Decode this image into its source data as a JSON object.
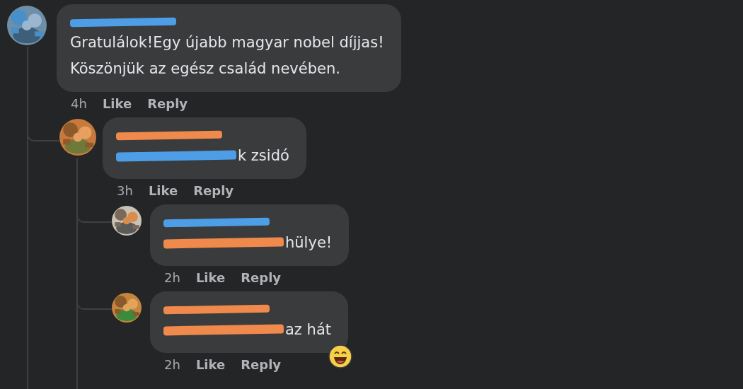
{
  "comments": [
    {
      "avatar": {
        "kind": "picture"
      },
      "name_redaction": {
        "color": "#4d9ee6"
      },
      "body": {
        "text": "Gratulálok!Egy újabb magyar nobel díjjas!\nKöszönjük az egész család nevében."
      },
      "time": "4h",
      "actions": [
        "Like",
        "Reply"
      ],
      "children": [
        {
          "avatar": {
            "kind": "picture"
          },
          "name_redaction": {
            "color": "#ef8a4c"
          },
          "body": {
            "redaction": {
              "color": "#4d9ee6"
            },
            "text": "k zsidó"
          },
          "time": "3h",
          "actions": [
            "Like",
            "Reply"
          ],
          "children": [
            {
              "avatar": {
                "kind": "picture"
              },
              "name_redaction": {
                "color": "#4d9ee6"
              },
              "body": {
                "redaction": {
                  "color": "#ef8a4c"
                },
                "text": "hülye!"
              },
              "time": "2h",
              "actions": [
                "Like",
                "Reply"
              ]
            },
            {
              "avatar": {
                "kind": "picture"
              },
              "name_redaction": {
                "color": "#ef8a4c"
              },
              "body": {
                "redaction": {
                  "color": "#ef8a4c"
                },
                "text": "az hát"
              },
              "reaction": {
                "kind": "laughing"
              },
              "time": "2h",
              "actions": [
                "Like",
                "Reply"
              ]
            }
          ]
        }
      ]
    }
  ]
}
